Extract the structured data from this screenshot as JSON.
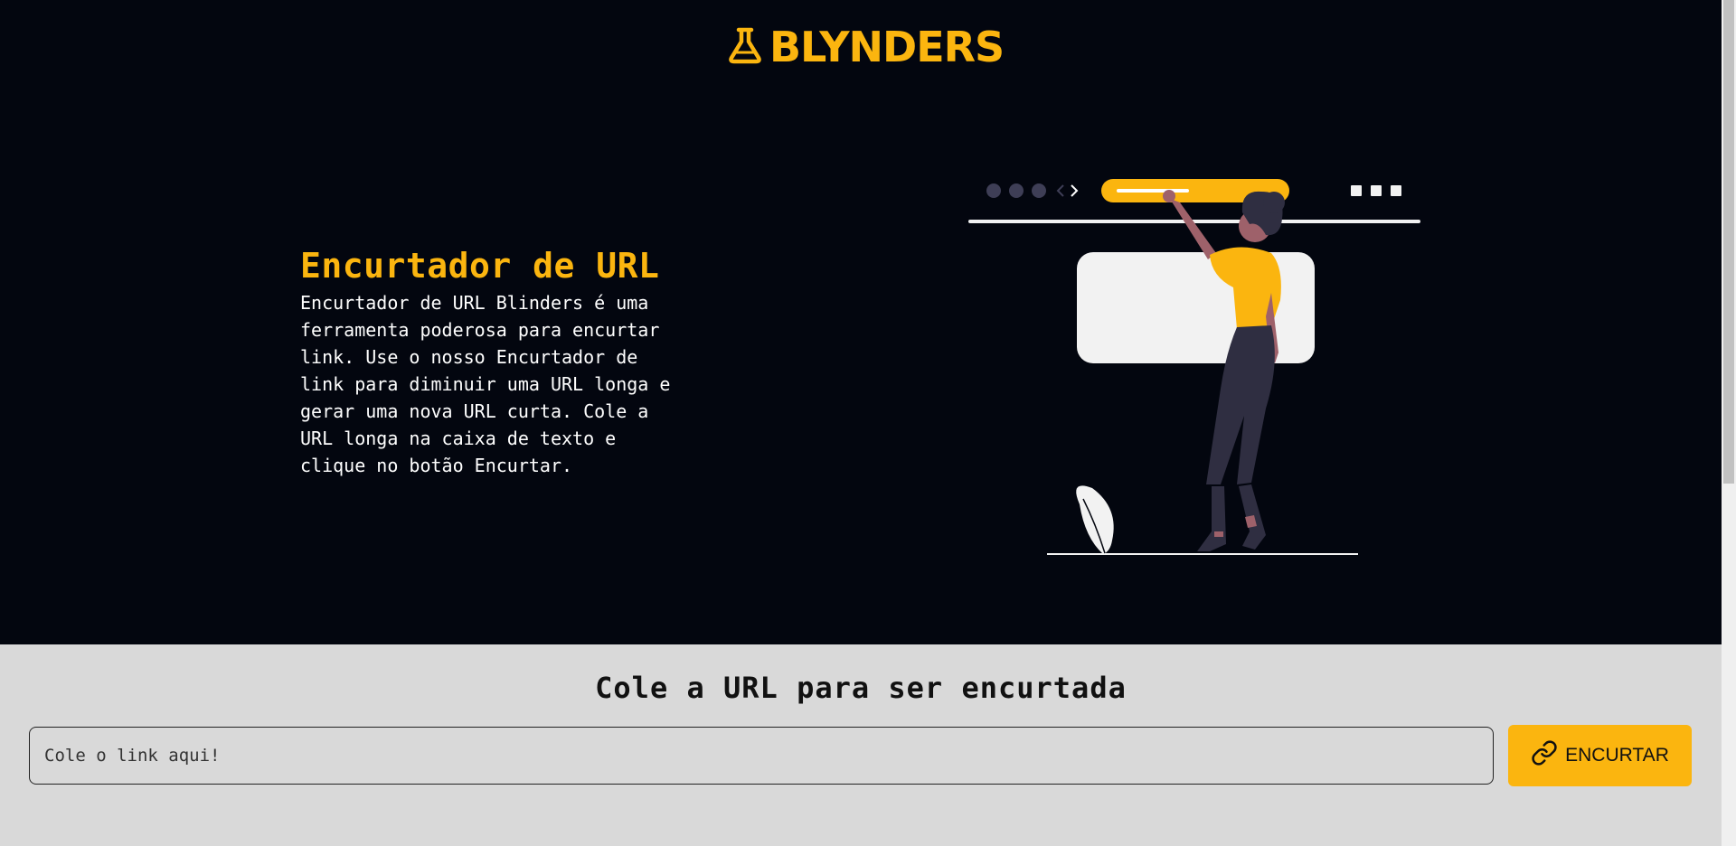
{
  "header": {
    "logo_text": "BLYNDERS",
    "logo_icon": "flask-icon"
  },
  "intro": {
    "title": "Encurtador de URL",
    "description": "Encurtador de URL Blinders é uma ferramenta poderosa para encurtar link. Use o nosso Encurtador de link para diminuir uma URL longa e gerar uma nova URL curta. Cole a URL longa na caixa de texto e clique no botão Encurtar."
  },
  "form": {
    "title": "Cole a URL para ser encurtada",
    "input_placeholder": "Cole o link aqui!",
    "button_label": "ENCURTAR",
    "button_icon": "link-icon"
  },
  "colors": {
    "accent": "#fbb50f",
    "hero_background": "#03060f",
    "form_background": "#d9d9d9"
  }
}
